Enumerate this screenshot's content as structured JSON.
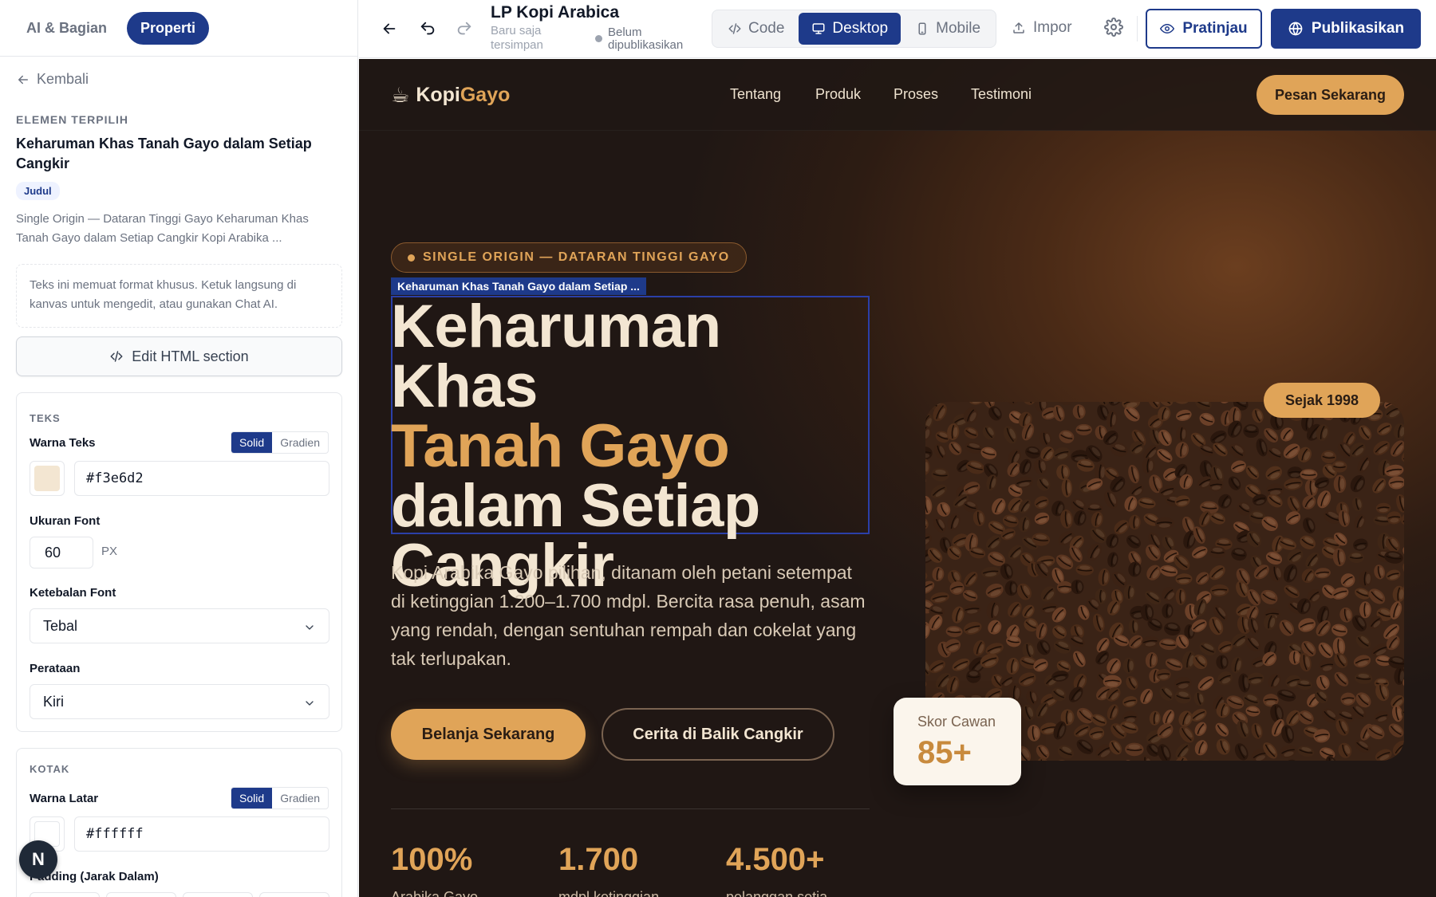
{
  "left_panel": {
    "tabs": [
      {
        "label": "AI & Bagian"
      },
      {
        "label": "Properti"
      }
    ],
    "back_label": "Kembali",
    "selected": {
      "section_label": "ELEMEN TERPILIH",
      "title": "Keharuman Khas Tanah Gayo dalam Setiap Cangkir",
      "type_badge": "Judul",
      "description": "Single Origin — Dataran Tinggi Gayo Keharuman Khas Tanah Gayo dalam Setiap Cangkir Kopi Arabika ..."
    },
    "note": "Teks ini memuat format khusus. Ketuk langsung di kanvas untuk mengedit, atau gunakan Chat AI.",
    "edit_html_label": "Edit HTML section",
    "teks": {
      "heading": "TEKS",
      "color_label": "Warna Teks",
      "mode_solid": "Solid",
      "mode_gradient": "Gradien",
      "color_value": "#f3e6d2",
      "font_size_label": "Ukuran Font",
      "font_size_value": "60",
      "font_size_unit": "PX",
      "font_weight_label": "Ketebalan Font",
      "font_weight_value": "Tebal",
      "align_label": "Perataan",
      "align_value": "Kiri"
    },
    "kotak": {
      "heading": "KOTAK",
      "bg_label": "Warna Latar",
      "mode_solid": "Solid",
      "mode_gradient": "Gradien",
      "bg_value": "#ffffff",
      "padding_label": "Padding (Jarak Dalam)"
    },
    "assistant_badge": "N"
  },
  "topbar": {
    "doc_title": "LP Kopi Arabica",
    "save_status": "Baru saja tersimpan",
    "publish_status": "Belum dipublikasikan",
    "views": [
      {
        "label": "Code",
        "icon": "code-icon"
      },
      {
        "label": "Desktop",
        "icon": "monitor-icon"
      },
      {
        "label": "Mobile",
        "icon": "phone-icon"
      }
    ],
    "active_view": "Desktop",
    "import_label": "Impor",
    "preview_label": "Pratinjau",
    "publish_label": "Publikasikan"
  },
  "site": {
    "logo_icon": "☕",
    "logo_part1": "Kopi",
    "logo_part2": "Gayo",
    "nav": [
      "Tentang",
      "Produk",
      "Proses",
      "Testimoni"
    ],
    "cta": "Pesan Sekarang",
    "eyebrow": "SINGLE ORIGIN — DATARAN TINGGI GAYO",
    "selection_tag": "Keharuman Khas Tanah Gayo dalam Setiap ...",
    "headline_1": "Keharuman Khas",
    "headline_2": "Tanah Gayo",
    "headline_3": "dalam Setiap",
    "headline_4": "Cangkir",
    "lead": "Kopi Arabika Gayo pilihan, ditanam oleh petani setempat di ketinggian 1.200–1.700 mdpl. Bercita rasa penuh, asam yang rendah, dengan sentuhan rempah dan cokelat yang tak terlupakan.",
    "btn_primary": "Belanja Sekarang",
    "btn_secondary": "Cerita di Balik Cangkir",
    "stats": [
      {
        "value": "100%",
        "label": "Arabika Gayo"
      },
      {
        "value": "1.700",
        "label": "mdpl ketinggian"
      },
      {
        "value": "4.500+",
        "label": "pelanggan setia"
      }
    ],
    "badge_since": "Sejak 1998",
    "score_label": "Skor Cawan",
    "score_value": "85+"
  },
  "colors": {
    "brand_primary": "#1e3a8a",
    "accent": "#e0a458",
    "cream": "#f3e6d2",
    "dark": "#201714"
  }
}
